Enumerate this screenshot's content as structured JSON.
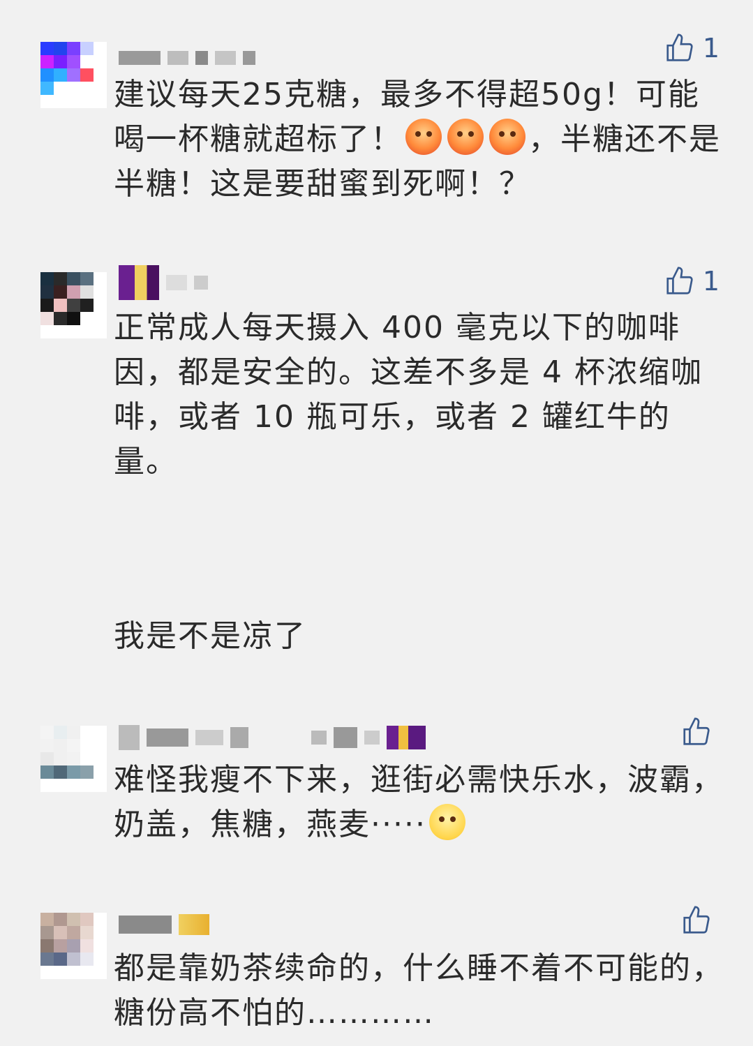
{
  "comments": [
    {
      "likes": "1",
      "text_before": "建议每天25克糖，最多不得超50g！可能喝一杯糖就超标了！",
      "emoji": "angry-face-icon",
      "emoji_count": 3,
      "text_after": "，半糖还不是半糖！这是要甜蜜到死啊！？",
      "avatar_colors": [
        "#2a3cff",
        "#2244ee",
        "#7a40ff",
        "#c8d0ff",
        "#ffffff",
        "#cc22ff",
        "#7a20ff",
        "#a050ff",
        "#ffffff",
        "#ffffff",
        "#2090ff",
        "#30b0ff",
        "#a070ff",
        "#ff5060",
        "#ffffff",
        "#40b8ff",
        "#ffffff",
        "#ffffff",
        "#ffffff",
        "#ffffff",
        "#ffffff",
        "#ffffff",
        "#ffffff",
        "#ffffff",
        "#ffffff"
      ]
    },
    {
      "likes": "1",
      "text": "正常成人每天摄入 400 毫克以下的咖啡因，都是安全的。这差不多是 4 杯浓缩咖啡，或者 10 瓶可乐，或者 2 罐红牛的量。",
      "text2": "我是不是凉了",
      "avatar_colors": [
        "#1a3040",
        "#2a2a2a",
        "#3a5060",
        "#5a7080",
        "#ffffff",
        "#203040",
        "#3a2020",
        "#d0a0b0",
        "#e0e0e0",
        "#ffffff",
        "#1a1a1a",
        "#f0c0c0",
        "#404040",
        "#202020",
        "#ffffff",
        "#f0e0e0",
        "#2a2a2a",
        "#101010",
        "#ffffff",
        "#ffffff",
        "#ffffff",
        "#ffffff",
        "#ffffff",
        "#ffffff",
        "#ffffff"
      ]
    },
    {
      "likes": "",
      "text_before": "难怪我瘦不下来，逛街必需快乐水，波霸，奶盖，焦糖，燕麦·····",
      "emoji": "smile-face-icon",
      "avatar_colors": [
        "#f4f4f4",
        "#e8eef0",
        "#f0f0f0",
        "#ffffff",
        "#ffffff",
        "#f2f2f2",
        "#f0f0f0",
        "#f4f4f4",
        "#ffffff",
        "#ffffff",
        "#e8e8e8",
        "#f0f0f0",
        "#f2f2f2",
        "#ffffff",
        "#ffffff",
        "#6a8a98",
        "#506878",
        "#7a9aa8",
        "#8aa0aa",
        "#ffffff",
        "#ffffff",
        "#ffffff",
        "#ffffff",
        "#ffffff",
        "#ffffff"
      ]
    },
    {
      "likes": "",
      "text": "都是靠奶茶续命的，什么睡不着不可能的，糖份高不怕的…………",
      "avatar_colors": [
        "#c8b0a0",
        "#b09890",
        "#d0c0b0",
        "#e0c8c0",
        "#ffffff",
        "#a89890",
        "#d8c0b8",
        "#c0a8a0",
        "#e8d8d0",
        "#ffffff",
        "#8a7870",
        "#b8a0a0",
        "#a8a0b0",
        "#f0e0e0",
        "#ffffff",
        "#6a7890",
        "#5a6888",
        "#c0c0d0",
        "#e8e8f0",
        "#ffffff",
        "#ffffff",
        "#ffffff",
        "#ffffff",
        "#ffffff",
        "#ffffff"
      ]
    }
  ]
}
